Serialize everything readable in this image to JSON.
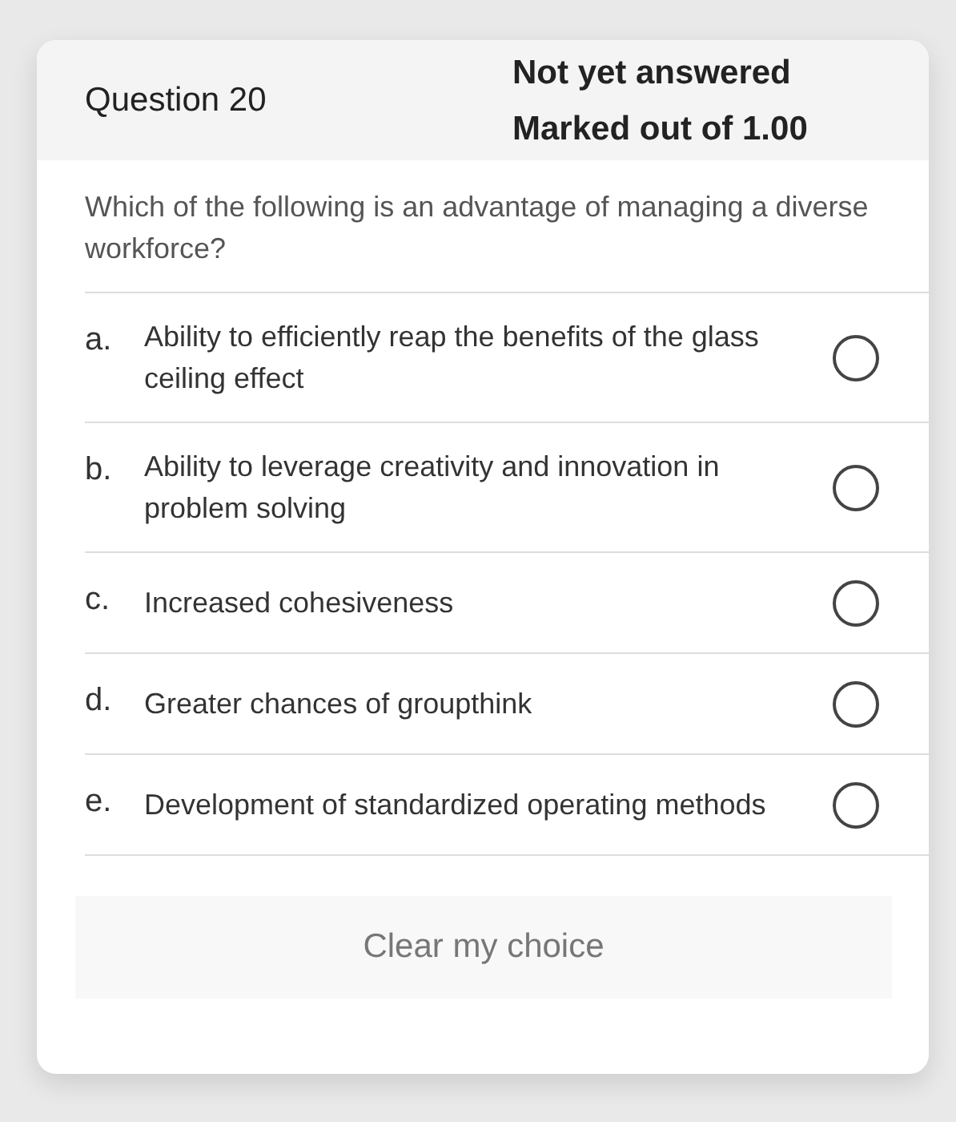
{
  "question": {
    "title": "Question 20",
    "status": "Not yet answered",
    "marks": "Marked out of 1.00"
  },
  "prompt": "Which of the following is an advantage of managing a diverse workforce?",
  "options": [
    {
      "letter": "a.",
      "text": "Ability to efficiently reap the benefits of the glass ceiling effect",
      "selected": false
    },
    {
      "letter": "b.",
      "text": "Ability to leverage creativity and innovation in problem solving",
      "selected": false
    },
    {
      "letter": "c.",
      "text": "Increased cohesiveness",
      "selected": false
    },
    {
      "letter": "d.",
      "text": "Greater chances of groupthink",
      "selected": false
    },
    {
      "letter": "e.",
      "text": "Development of standardized operating methods",
      "selected": false
    }
  ],
  "clear_button": "Clear my choice"
}
